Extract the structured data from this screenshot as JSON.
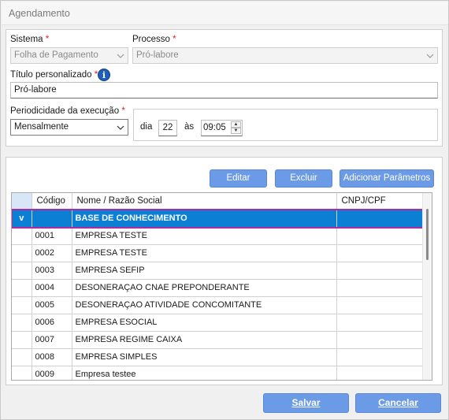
{
  "window": {
    "title": "Agendamento"
  },
  "form": {
    "sistema_label": "Sistema",
    "sistema_value": "Folha de Pagamento",
    "processo_label": "Processo",
    "processo_value": "Pró-labore",
    "titulo_label": "Título personalizado",
    "titulo_value": "Pró-labore",
    "required_mark": "*",
    "info_glyph": "i",
    "periodicidade_label": "Periodicidade da execução",
    "periodicidade_value": "Mensalmente",
    "dia_label": "dia",
    "dia_value": "22",
    "as_label": "às",
    "hora_value": "09:05"
  },
  "toolbar": {
    "editar_label": "Editar",
    "excluir_label": "Excluir",
    "adicionar_label": "Adicionar Parâmetros"
  },
  "table": {
    "columns": [
      "",
      "Código",
      "Nome / Razão Social",
      "CNPJ/CPF"
    ],
    "rows": [
      {
        "marker": "v",
        "codigo": "",
        "nome": "BASE DE CONHECIMENTO",
        "cnpj": ""
      },
      {
        "marker": "",
        "codigo": "0001",
        "nome": "EMPRESA TESTE",
        "cnpj": ""
      },
      {
        "marker": "",
        "codigo": "0002",
        "nome": "EMPRESA TESTE",
        "cnpj": ""
      },
      {
        "marker": "",
        "codigo": "0003",
        "nome": "EMPRESA SEFIP",
        "cnpj": ""
      },
      {
        "marker": "",
        "codigo": "0004",
        "nome": "DESONERAÇAO CNAE PREPONDERANTE",
        "cnpj": ""
      },
      {
        "marker": "",
        "codigo": "0005",
        "nome": "DESONERAÇAO ATIVIDADE CONCOMITANTE",
        "cnpj": ""
      },
      {
        "marker": "",
        "codigo": "0006",
        "nome": "EMPRESA ESOCIAL",
        "cnpj": ""
      },
      {
        "marker": "",
        "codigo": "0007",
        "nome": "EMPRESA REGIME CAIXA",
        "cnpj": ""
      },
      {
        "marker": "",
        "codigo": "0008",
        "nome": "EMPRESA SIMPLES",
        "cnpj": ""
      },
      {
        "marker": "",
        "codigo": "0009",
        "nome": "Empresa testee",
        "cnpj": ""
      }
    ]
  },
  "footer": {
    "salvar_label": "Salvar",
    "cancelar_label": "Cancelar"
  },
  "colors": {
    "accent_button": "#6b9be6",
    "selected_row": "#0a7fd4",
    "selection_outline": "#b02aa0",
    "required": "#e02020"
  }
}
